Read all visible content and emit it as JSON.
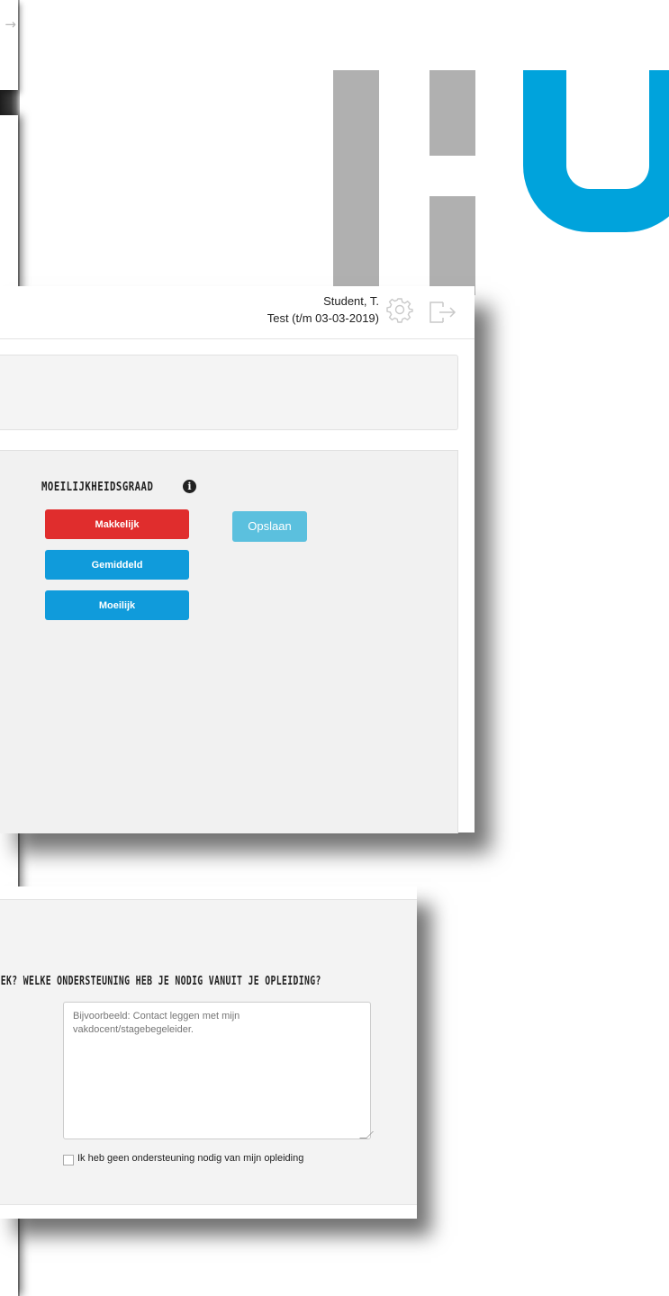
{
  "header": {
    "user_name": "Student, T.",
    "user_test": "Test (t/m 03-03-2019)",
    "settings_icon": "gear-icon",
    "logout_icon": "logout-icon"
  },
  "difficulty": {
    "title": "MOEILIJKHEIDSGRAAD",
    "info_icon": "info-icon",
    "info_glyph": "i",
    "options": [
      "Makkelijk",
      "Gemiddeld",
      "Moeilijk"
    ],
    "selected": "Makkelijk",
    "save_label": "Opslaan"
  },
  "support": {
    "question": "KPLEK? WELKE ONDERSTEUNING HEB JE NODIG VANUIT JE OPLEIDING?",
    "placeholder": "Bijvoorbeeld: Contact leggen met mijn vakdocent/stagebegeleider.",
    "checkbox_label": "Ik heb geen ondersteuning nodig van mijn opleiding",
    "checkbox_checked": false
  },
  "colors": {
    "brand_blue": "#00a3dc",
    "brand_gray": "#b0b0b0",
    "selected_red": "#e02d2d",
    "button_blue": "#109bdb",
    "save_light_blue": "#5bc0de"
  },
  "left_card_arrow": "→"
}
